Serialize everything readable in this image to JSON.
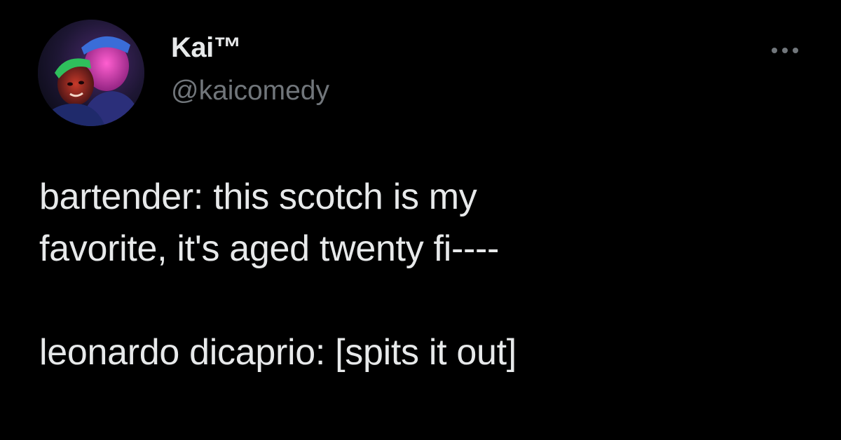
{
  "author": {
    "display_name": "Kai™",
    "handle": "@kaicomedy",
    "avatar_icon": "profile-photo"
  },
  "more_icon": "more-horizontal-icon",
  "tweet": {
    "lines": [
      "bartender: this scotch is my",
      "favorite, it's aged twenty fi----",
      "",
      "leonardo dicaprio: [spits it out]"
    ]
  },
  "colors": {
    "background": "#000000",
    "primary_text": "#e7e9ea",
    "secondary_text": "#71767b"
  }
}
